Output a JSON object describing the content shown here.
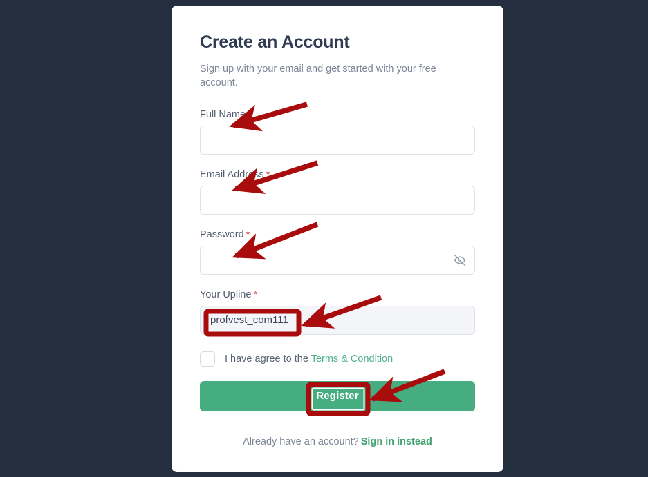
{
  "theme": {
    "page_background": "#232f3e",
    "card_background": "#ffffff",
    "accent_green": "#46ad80",
    "link_green": "#52b08a",
    "required_red": "#d9534f",
    "annotation_red": "#a90c0c"
  },
  "card": {
    "title": "Create an Account",
    "subtitle": "Sign up with your email and get started with your free account."
  },
  "form": {
    "fields": [
      {
        "label": "Full Name",
        "required_mark": "*",
        "value": "",
        "placeholder": "",
        "readonly": false,
        "has_toggle": false
      },
      {
        "label": "Email Address",
        "required_mark": "*",
        "value": "",
        "placeholder": "",
        "readonly": false,
        "has_toggle": false
      },
      {
        "label": "Password",
        "required_mark": "*",
        "value": "",
        "placeholder": "",
        "readonly": false,
        "has_toggle": true,
        "toggle_icon": "eye-off-icon"
      },
      {
        "label": "Your Upline",
        "required_mark": "*",
        "value": "profvest_com111",
        "placeholder": "",
        "readonly": true,
        "has_toggle": false
      }
    ],
    "terms": {
      "checked": false,
      "text": "I have agree to the",
      "link_text": "Terms & Condition"
    },
    "submit_label": "Register"
  },
  "footer": {
    "text": "Already have an account?",
    "link_text": "Sign in instead"
  },
  "annotations": {
    "arrows": [
      {
        "name": "arrow-to-full-name-input",
        "target": "full-name-input"
      },
      {
        "name": "arrow-to-email-input",
        "target": "email-input"
      },
      {
        "name": "arrow-to-password-input",
        "target": "password-input"
      },
      {
        "name": "arrow-to-upline-input",
        "target": "upline-input"
      },
      {
        "name": "arrow-to-register-button",
        "target": "register-button"
      }
    ],
    "boxes": [
      {
        "name": "highlight-box-upline-value",
        "target": "upline-input"
      },
      {
        "name": "highlight-box-register-button",
        "target": "register-button"
      }
    ]
  }
}
